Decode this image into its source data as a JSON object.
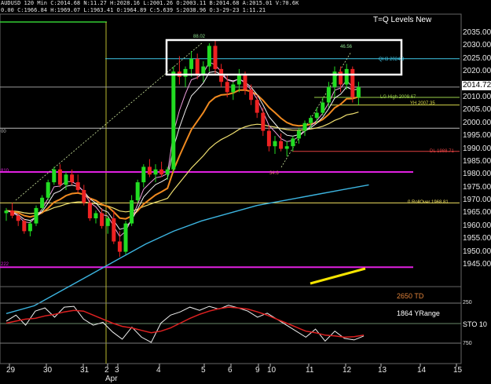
{
  "header": {
    "line1": "AUDUSD 120 Min  C:2014.68  N:11.27  H:2028.16  L:2001.26  O:2003.11  B:2014.68  A:2015.01  V:70.6K",
    "line2": "0.00  C:1966.84  H:1969.07  L:1963.41  O:1964.89  C:5.639  S:2038.96  O:3-29-23  1:11.21"
  },
  "title": "T=Q Levels New",
  "chart_data": {
    "type": "candlestick",
    "title": "T=Q Levels New",
    "ylim": [
      1935,
      2040
    ],
    "y_ticks": [
      "2035.00",
      "2030.00",
      "2025.00",
      "2020.00",
      "2015.00",
      "2010.00",
      "2005.00",
      "2000.00",
      "1995.00",
      "1990.00",
      "1985.00",
      "1980.00",
      "1975.00",
      "1970.00",
      "1965.00",
      "1960.00",
      "1955.00",
      "1950.00",
      "1945.00"
    ],
    "current_price": "2014.72",
    "x_ticks": [
      "29",
      "30",
      "31",
      "2",
      "3",
      "4",
      "5",
      "6",
      "9",
      "10",
      "11",
      "12",
      "13",
      "14",
      "15"
    ],
    "x_sublabel": "Apr",
    "candles": [
      [
        1965,
        1967,
        1962,
        1966
      ],
      [
        1966,
        1969,
        1963,
        1964
      ],
      [
        1964,
        1965,
        1960,
        1962
      ],
      [
        1962,
        1963,
        1957,
        1958
      ],
      [
        1958,
        1962,
        1956,
        1961
      ],
      [
        1961,
        1968,
        1960,
        1967
      ],
      [
        1967,
        1972,
        1966,
        1971
      ],
      [
        1971,
        1978,
        1970,
        1977
      ],
      [
        1977,
        1983,
        1976,
        1982
      ],
      [
        1982,
        1984,
        1975,
        1976
      ],
      [
        1976,
        1981,
        1974,
        1980
      ],
      [
        1980,
        1982,
        1976,
        1977
      ],
      [
        1977,
        1980,
        1973,
        1974
      ],
      [
        1974,
        1976,
        1968,
        1969
      ],
      [
        1969,
        1971,
        1962,
        1963
      ],
      [
        1963,
        1966,
        1961,
        1965
      ],
      [
        1965,
        1967,
        1959,
        1960
      ],
      [
        1960,
        1964,
        1957,
        1963
      ],
      [
        1963,
        1966,
        1953,
        1954
      ],
      [
        1954,
        1958,
        1948,
        1950
      ],
      [
        1950,
        1962,
        1949,
        1961
      ],
      [
        1961,
        1972,
        1960,
        1970
      ],
      [
        1970,
        1978,
        1969,
        1977
      ],
      [
        1977,
        1984,
        1975,
        1983
      ],
      [
        1983,
        1986,
        1979,
        1980
      ],
      [
        1980,
        1984,
        1977,
        1982
      ],
      [
        1982,
        1985,
        1979,
        1980
      ],
      [
        1980,
        1983,
        1978,
        1982
      ],
      [
        1982,
        2022,
        1981,
        2020
      ],
      [
        2020,
        2026,
        2015,
        2018
      ],
      [
        2018,
        2022,
        2014,
        2021
      ],
      [
        2021,
        2028,
        2018,
        2025
      ],
      [
        2025,
        2027,
        2017,
        2019
      ],
      [
        2019,
        2024,
        2016,
        2022
      ],
      [
        2022,
        2031,
        2020,
        2030
      ],
      [
        2030,
        2032,
        2019,
        2021
      ],
      [
        2021,
        2023,
        2014,
        2016
      ],
      [
        2016,
        2019,
        2010,
        2012
      ],
      [
        2012,
        2016,
        2009,
        2015
      ],
      [
        2015,
        2021,
        2012,
        2019
      ],
      [
        2019,
        2020,
        2011,
        2013
      ],
      [
        2013,
        2015,
        2007,
        2009
      ],
      [
        2009,
        2011,
        2002,
        2004
      ],
      [
        2004,
        2006,
        1995,
        1997
      ],
      [
        1997,
        1999,
        1989,
        1991
      ],
      [
        1991,
        1995,
        1988,
        1993
      ],
      [
        1993,
        1996,
        1989,
        1990
      ],
      [
        1990,
        1993,
        1987,
        1991
      ],
      [
        1991,
        1995,
        1989,
        1994
      ],
      [
        1994,
        1998,
        1992,
        1997
      ],
      [
        1997,
        2001,
        1995,
        2000
      ],
      [
        2000,
        2003,
        1998,
        2002
      ],
      [
        2002,
        2006,
        2000,
        2004
      ],
      [
        2004,
        2010,
        2003,
        2008
      ],
      [
        2008,
        2016,
        2006,
        2014
      ],
      [
        2014,
        2022,
        2010,
        2020
      ],
      [
        2020,
        2022,
        2012,
        2015
      ],
      [
        2015,
        2023,
        2013,
        2021
      ],
      [
        2021,
        2022,
        2008,
        2010
      ],
      [
        2010,
        2016,
        2007,
        2014
      ]
    ],
    "horizontal_levels": [
      {
        "name": "magenta-upper",
        "value": 1981,
        "color": "#e020e0",
        "label": "810"
      },
      {
        "name": "magenta-lower",
        "value": 1944,
        "color": "#e020e0",
        "label": "222"
      },
      {
        "name": "rollover",
        "value": 1969,
        "color": "#f0e060",
        "label": "0 RollOver 1968.81"
      },
      {
        "name": "white-1998",
        "value": 1998,
        "color": "#bbbbbb",
        "label": "00"
      },
      {
        "name": "qh3",
        "value": 2025,
        "color": "#40c8e8",
        "label": "QH3 2024.8"
      },
      {
        "name": "lg-high",
        "value": 2010,
        "color": "#9ad04a",
        "label": "LG High 2009.67"
      },
      {
        "name": "yh",
        "value": 2007,
        "color": "#d8d84a",
        "label": "YH 2007.35"
      },
      {
        "name": "dl",
        "value": 1989,
        "color": "#e04040",
        "label": "DL 1988.71"
      },
      {
        "name": "white-2014",
        "value": 2014,
        "color": "#999999",
        "label": ""
      }
    ],
    "annotations": [
      "88.02",
      "46.56",
      "34.6"
    ],
    "rect_box": {
      "label": "resistance-zone"
    },
    "oscillator": {
      "labels": [
        "2650 TD",
        "1864 YRange",
        "STO 10"
      ],
      "ticks": [
        "250",
        "750"
      ]
    }
  }
}
